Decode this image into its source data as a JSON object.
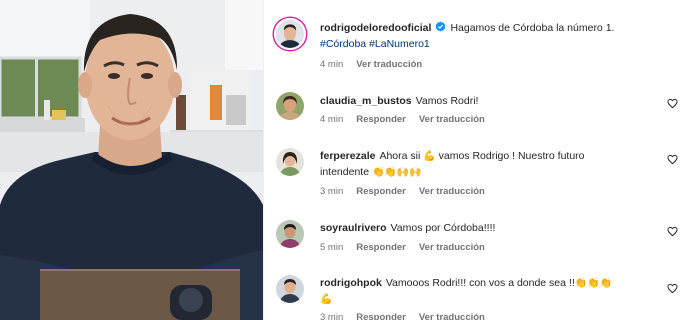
{
  "post": {
    "username": "rodrigodeloredooficial",
    "caption": "Hagamos de Córdoba la número 1.",
    "hashtags": [
      "#Córdoba",
      "#LaNumero1"
    ],
    "time": "4 min",
    "see_translation": "Ver traducción"
  },
  "comments": [
    {
      "username": "claudia_m_bustos",
      "text": "Vamos Rodri!",
      "emojis_after": "",
      "time": "4 min",
      "reply": "Responder",
      "translate": "Ver traducción"
    },
    {
      "username": "ferperezale",
      "text_before": "Ahora sii",
      "emoji_mid": "💪",
      "text_line1": "vamos Rodrigo ! Nuestro futuro",
      "text_line2": "intendente",
      "emojis_after": "👏👏🙌🙌",
      "time": "3 min",
      "reply": "Responder",
      "translate": "Ver traducción"
    },
    {
      "username": "soyraulrivero",
      "text": "Vamos por Córdoba!!!!",
      "emojis_after": "",
      "time": "5 min",
      "reply": "Responder",
      "translate": "Ver traducción"
    },
    {
      "username": "rodrigohpok",
      "text": "Vamooos Rodri!!! con vos a donde sea !!",
      "emojis_after": "👏👏👏",
      "emoji_line2": "💪",
      "time": "3 min",
      "reply": "Responder",
      "translate": "Ver traducción"
    }
  ],
  "icons": [
    "verified-badge-icon",
    "heart-icon"
  ],
  "colors": {
    "link": "#00376b",
    "meta": "#737373",
    "verified": "#0095f6",
    "ring": "#d6249f"
  }
}
